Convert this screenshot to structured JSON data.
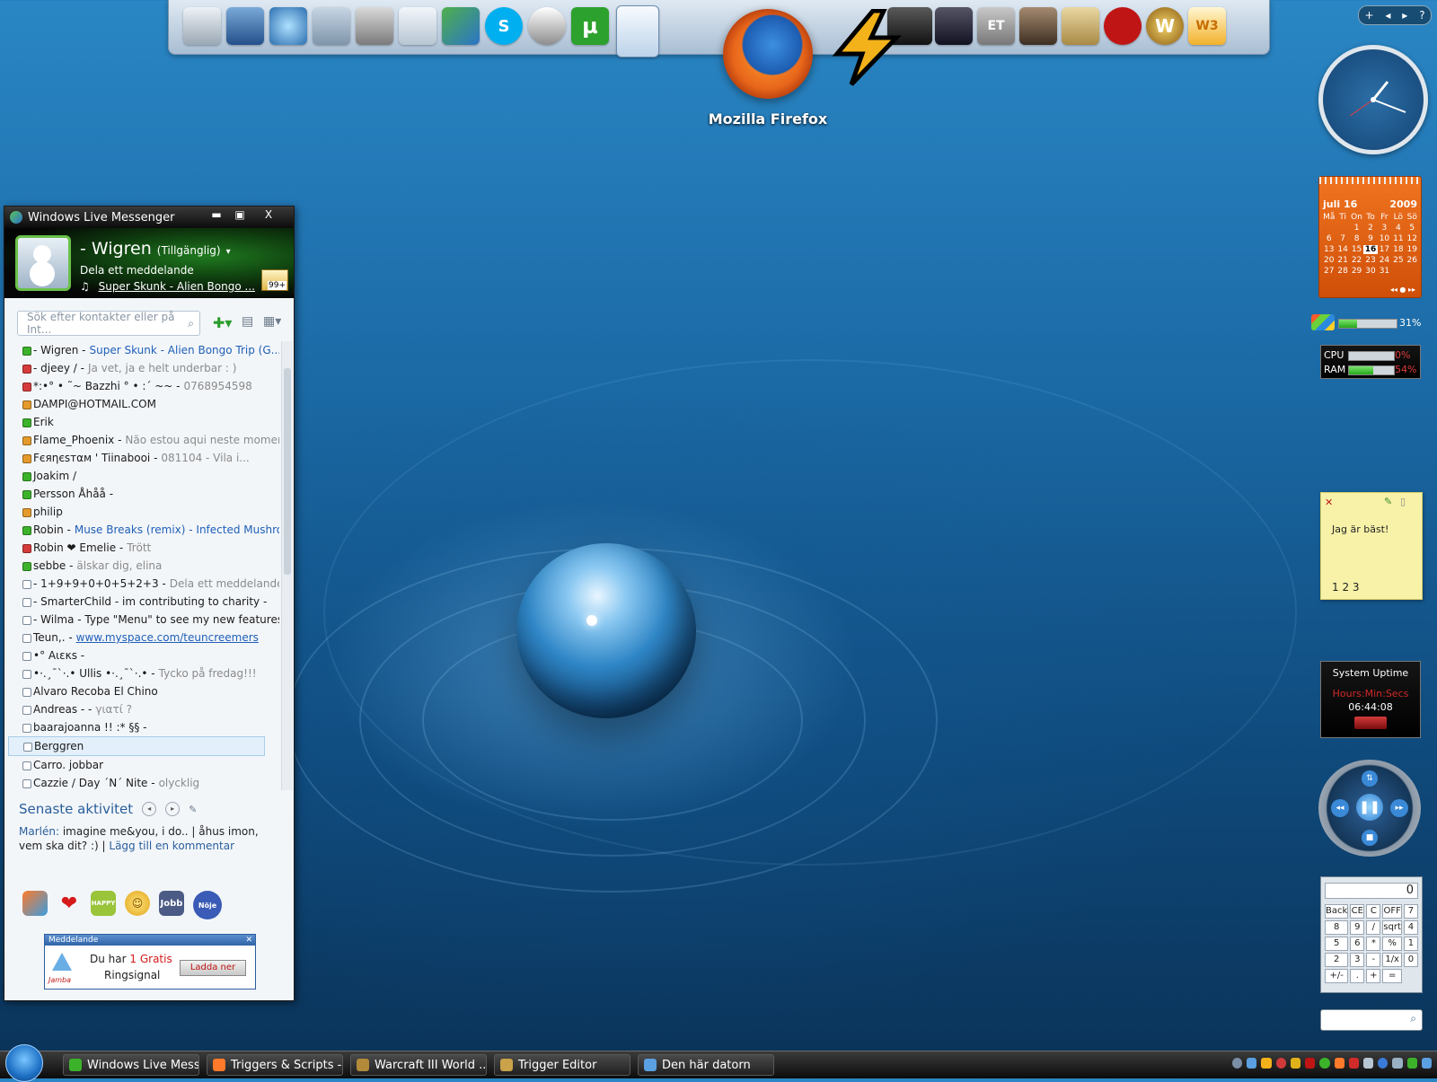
{
  "desktop": {
    "firefox_label": "Mozilla Firefox"
  },
  "dock": {
    "ctrl_plus": "+",
    "ctrl_left": "◂",
    "ctrl_right": "▸",
    "ctrl_help": "?",
    "icons": [
      "computer-icon",
      "monitor-icon",
      "network-icon",
      "folder-icon",
      "tools-icon",
      "recycle-bin-icon",
      "messenger-icon",
      "skype-icon",
      "headset-icon",
      "utorrent-icon",
      "document-icon",
      "firefox-icon",
      "winamp-icon",
      "wings-icon",
      "game-icon",
      "et-icon",
      "portrait-icon",
      "scroll-icon",
      "garena-icon",
      "wow-icon",
      "wc3-icon"
    ],
    "utorrent_glyph": "µ"
  },
  "messenger": {
    "title": "Windows Live Messenger",
    "title_buttons": [
      "▬",
      "▣",
      "X"
    ],
    "user_name": "-   Wigren",
    "user_status": "(Tillgänglig)",
    "personal_message": "Dela ett meddelande",
    "now_playing": "Super Skunk - Alien Bongo ...",
    "mail_badge": "99+",
    "search_placeholder": "Sök efter kontakter eller på Int...",
    "contacts": [
      {
        "status": "online",
        "name": "-   Wigren -",
        "extra": "Super Skunk - Alien Bongo Trip (G...",
        "kind": "song"
      },
      {
        "status": "busy",
        "name": "- djeey / -",
        "extra": "Ja vet, ja e helt underbar : )",
        "kind": "msg"
      },
      {
        "status": "busy",
        "name": "*:•° • ˜~ Bazzhi ° • :´ ~~ -",
        "extra": "0768954598",
        "kind": "msg"
      },
      {
        "status": "away",
        "name": "DAMPI@HOTMAIL.COM",
        "extra": "",
        "kind": "msg"
      },
      {
        "status": "online",
        "name": "Erik",
        "extra": "",
        "kind": "msg"
      },
      {
        "status": "away",
        "name": "Flame_Phoenix -",
        "extra": "Não estou aqui neste momento",
        "kind": "msg"
      },
      {
        "status": "away",
        "name": "Fєяηєѕтαм '          Tiinabooi -",
        "extra": "081104 - Vila i...",
        "kind": "msg"
      },
      {
        "status": "online",
        "name": "Joakim /",
        "extra": "",
        "kind": "msg"
      },
      {
        "status": "online",
        "name": "Persson    Åhåå -",
        "extra": "",
        "kind": "msg"
      },
      {
        "status": "away",
        "name": "philip",
        "extra": "",
        "kind": "msg"
      },
      {
        "status": "online",
        "name": "Robin -",
        "extra": "Muse Breaks (remix) - Infected Mushro...",
        "kind": "song"
      },
      {
        "status": "busy",
        "name": "Robin ❤ Emelie -",
        "extra": "Trött",
        "kind": "msg"
      },
      {
        "status": "online",
        "name": "sebbe -",
        "extra": "älskar dig, elina",
        "kind": "msg"
      },
      {
        "status": "offline",
        "name": "-      1+9+9+0+0+5+2+3 -",
        "extra": "Dela ett meddelande.",
        "kind": "msg"
      },
      {
        "status": "offline",
        "name": "- SmarterChild - im contributing to charity -",
        "extra": "",
        "kind": "msg"
      },
      {
        "status": "offline",
        "name": "- Wilma - Type \"Menu\" to see my new features",
        "extra": "",
        "kind": "msg"
      },
      {
        "status": "offline",
        "name": "Teun,. -",
        "extra": "www.myspace.com/teuncreemers",
        "kind": "link"
      },
      {
        "status": "offline",
        "name": "•°    Aιεκѕ -",
        "extra": "",
        "kind": "msg"
      },
      {
        "status": "offline",
        "name": "•·.¸¯`·.• Ullis •·.¸¯`·.• -",
        "extra": "Tycko på fredag!!!",
        "kind": "msg"
      },
      {
        "status": "offline",
        "name": "Alvaro Recoba El Chino",
        "extra": "",
        "kind": "msg"
      },
      {
        "status": "offline",
        "name": "Andreas - -",
        "extra": "γιατί ?",
        "kind": "msg"
      },
      {
        "status": "offline",
        "name": "baarajoanna !! :* §§ -",
        "extra": "",
        "kind": "msg"
      },
      {
        "status": "offline",
        "name": "Berggren",
        "extra": "",
        "kind": "msg",
        "selected": true
      },
      {
        "status": "offline",
        "name": "Carro.    jobbar",
        "extra": "",
        "kind": "msg"
      },
      {
        "status": "offline",
        "name": "Cazzie / Day ´N´ Nite -",
        "extra": "olycklig",
        "kind": "msg"
      }
    ],
    "activity_title": "Senaste aktivitet",
    "activity_author": "Marlén:",
    "activity_text": " imagine me&you, i do.. | åhus imon, vem ska dit? :) | ",
    "activity_link": "Lägg till en kommentar",
    "toolbar": [
      "msn-butterfly-icon",
      "heart-icon",
      "happy-icon",
      "smiley-icon",
      "jobb-icon",
      "noje-icon"
    ],
    "toolbar_jobb": "Jobb",
    "toolbar_noje": "Nöje",
    "toolbar_happy": "HAPPY",
    "ad_title": "Meddelande",
    "ad_text_pre": "Du har",
    "ad_text_highlight": "1 Gratis",
    "ad_text_post": "Ringsignal",
    "ad_button": "Ladda ner",
    "ad_brand": "Jamba"
  },
  "calendar": {
    "month": "juli 16",
    "year": "2009",
    "weekdays": [
      "Må",
      "Ti",
      "On",
      "To",
      "Fr",
      "Lö",
      "Sö"
    ],
    "days": [
      "",
      "",
      "1",
      "2",
      "3",
      "4",
      "5",
      "6",
      "7",
      "8",
      "9",
      "10",
      "11",
      "12",
      "13",
      "14",
      "15",
      "16",
      "17",
      "18",
      "19",
      "20",
      "21",
      "22",
      "23",
      "24",
      "25",
      "26",
      "27",
      "28",
      "29",
      "30",
      "31",
      "",
      ""
    ],
    "today": "16",
    "nav": "◂◂  ●  ▸▸"
  },
  "gadgets": {
    "disk_percent_label": "31%",
    "disk_percent": 31,
    "cpu_label": "CPU",
    "cpu_value": "0%",
    "cpu_percent": 0,
    "ram_label": "RAM",
    "ram_value": "54%",
    "ram_percent": 54,
    "note_text": "Jag är bäst!",
    "note_pages": "1 2 3",
    "uptime_title": "System Uptime",
    "uptime_format": "Hours:Min:Secs",
    "uptime_value": "06:44:08",
    "calc_display": "0",
    "calc_keys": [
      "Back",
      "CE",
      "C",
      "OFF",
      "7",
      "8",
      "9",
      "/",
      "sqrt",
      "4",
      "5",
      "6",
      "*",
      "%",
      "1",
      "2",
      "3",
      "-",
      "1/x",
      "0",
      "+/-",
      ".",
      "+",
      "="
    ]
  },
  "taskbar": {
    "tasks": [
      "Windows Live Mess...",
      "Triggers & Scripts - ...",
      "Warcraft III World ...",
      "Trigger Editor",
      "Den här datorn"
    ]
  },
  "colors": {
    "online": "#3cb22b",
    "busy": "#d63b3b",
    "away": "#e49a2b",
    "offline": "#ffffff"
  }
}
